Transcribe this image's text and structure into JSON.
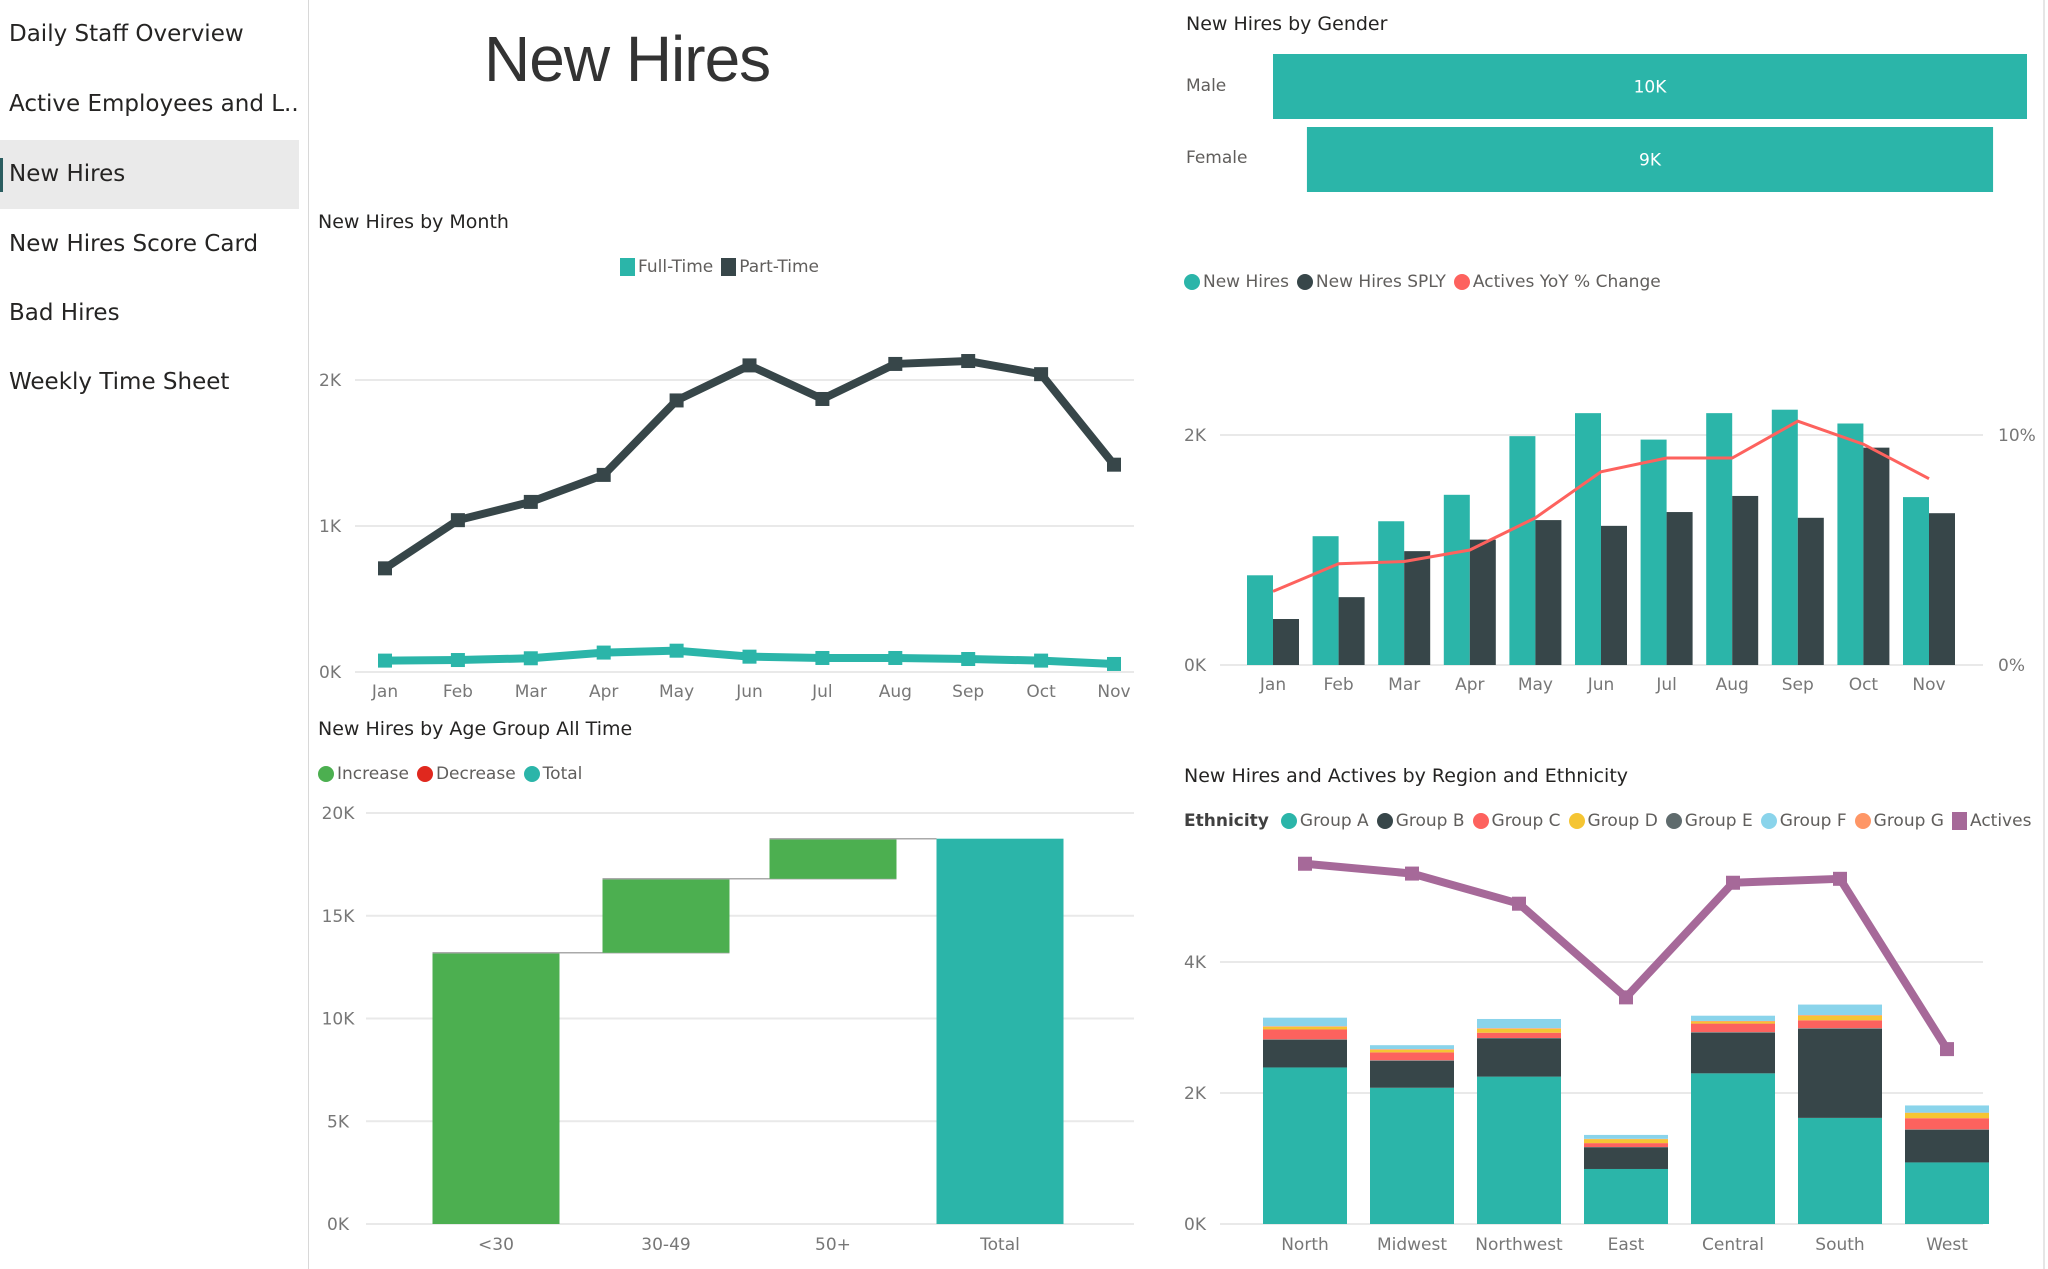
{
  "sidebar": {
    "items": [
      {
        "label": "Daily Staff Overview",
        "active": false
      },
      {
        "label": "Active Employees and L...",
        "active": false
      },
      {
        "label": "New Hires",
        "active": true
      },
      {
        "label": "New Hires Score Card",
        "active": false
      },
      {
        "label": "Bad Hires",
        "active": false
      },
      {
        "label": "Weekly Time Sheet",
        "active": false
      }
    ]
  },
  "page": {
    "title": "New Hires"
  },
  "colors": {
    "teal": "#2bb5a9",
    "dark": "#374649",
    "coral": "#fd625e",
    "green": "#4caf50",
    "red": "#e0281e",
    "yellow": "#f5c533",
    "grey": "#5f6b6d",
    "lightblue": "#8ad4eb",
    "orange": "#fe9666",
    "purple": "#a66999"
  },
  "chart_data": [
    {
      "id": "by_month",
      "type": "line",
      "title": "New Hires by Month",
      "legend": [
        {
          "name": "Full-Time",
          "color": "#2bb5a9"
        },
        {
          "name": "Part-Time",
          "color": "#374649"
        }
      ],
      "categories": [
        "Jan",
        "Feb",
        "Mar",
        "Apr",
        "May",
        "Jun",
        "Jul",
        "Aug",
        "Sep",
        "Oct",
        "Nov"
      ],
      "series": [
        {
          "name": "Full-Time",
          "values": [
            78,
            82,
            94,
            133,
            146,
            105,
            96,
            96,
            89,
            78,
            55
          ]
        },
        {
          "name": "Part-Time",
          "values": [
            710,
            1040,
            1165,
            1350,
            1860,
            2100,
            1870,
            2110,
            2130,
            2040,
            1420
          ]
        }
      ],
      "yticks": [
        "0K",
        "1K",
        "2K"
      ],
      "ytick_values": [
        0,
        1000,
        2000
      ],
      "ylim": [
        0,
        2000
      ],
      "grid": true,
      "legend_position": "top-center"
    },
    {
      "id": "by_gender",
      "type": "bar",
      "subtype": "funnel",
      "title": "New Hires by Gender",
      "categories": [
        "Male",
        "Female"
      ],
      "values": [
        10000,
        9100
      ],
      "data_labels": [
        "10K",
        "9K"
      ]
    },
    {
      "id": "new_vs_sply",
      "type": "bar",
      "subtype": "combo-clustered-bar-line",
      "title": "",
      "legend": [
        {
          "name": "New Hires",
          "color": "#2bb5a9"
        },
        {
          "name": "New Hires SPLY",
          "color": "#374649"
        },
        {
          "name": "Actives YoY % Change",
          "color": "#fd625e"
        }
      ],
      "categories": [
        "Jan",
        "Feb",
        "Mar",
        "Apr",
        "May",
        "Jun",
        "Jul",
        "Aug",
        "Sep",
        "Oct",
        "Nov"
      ],
      "series": [
        {
          "name": "New Hires",
          "axis": "left",
          "values": [
            780,
            1120,
            1250,
            1480,
            1990,
            2190,
            1960,
            2190,
            2220,
            2100,
            1460
          ]
        },
        {
          "name": "New Hires SPLY",
          "axis": "left",
          "values": [
            400,
            590,
            990,
            1090,
            1260,
            1210,
            1330,
            1470,
            1280,
            1890,
            1320
          ]
        },
        {
          "name": "Actives YoY % Change",
          "axis": "right",
          "values": [
            3.2,
            4.4,
            4.5,
            5.0,
            6.4,
            8.4,
            9.0,
            9.0,
            10.6,
            9.6,
            8.1
          ]
        }
      ],
      "yticks": [
        "0K",
        "2K"
      ],
      "ytick_values": [
        0,
        2000
      ],
      "ylim": [
        0,
        2000
      ],
      "y2ticks": [
        "0%",
        "10%"
      ],
      "y2tick_values": [
        0,
        10
      ],
      "y2lim": [
        0,
        10
      ],
      "grid": true,
      "legend_position": "top-left"
    },
    {
      "id": "by_age",
      "type": "bar",
      "subtype": "waterfall",
      "title": "New Hires by Age Group All Time",
      "legend": [
        {
          "name": "Increase",
          "color": "#4caf50"
        },
        {
          "name": "Decrease",
          "color": "#e0281e"
        },
        {
          "name": "Total",
          "color": "#2bb5a9"
        }
      ],
      "categories": [
        "<30",
        "30-49",
        "50+",
        "Total"
      ],
      "values": [
        13200,
        3600,
        1950,
        18750
      ],
      "kinds": [
        "increase",
        "increase",
        "increase",
        "total"
      ],
      "yticks": [
        "0K",
        "5K",
        "10K",
        "15K",
        "20K"
      ],
      "ytick_values": [
        0,
        5000,
        10000,
        15000,
        20000
      ],
      "ylim": [
        0,
        20000
      ],
      "grid": true,
      "legend_position": "top-left"
    },
    {
      "id": "by_region",
      "type": "bar",
      "subtype": "stacked-bar-with-line",
      "title": "New Hires and Actives by Region and Ethnicity",
      "legend_title": "Ethnicity",
      "legend": [
        {
          "name": "Group A",
          "color": "#2bb5a9",
          "shape": "dot"
        },
        {
          "name": "Group B",
          "color": "#374649",
          "shape": "dot"
        },
        {
          "name": "Group C",
          "color": "#fd625e",
          "shape": "dot"
        },
        {
          "name": "Group D",
          "color": "#f5c533",
          "shape": "dot"
        },
        {
          "name": "Group E",
          "color": "#5f6b6d",
          "shape": "dot"
        },
        {
          "name": "Group F",
          "color": "#8ad4eb",
          "shape": "dot"
        },
        {
          "name": "Group G",
          "color": "#fe9666",
          "shape": "dot"
        },
        {
          "name": "Actives",
          "color": "#a66999",
          "shape": "square"
        }
      ],
      "categories": [
        "North",
        "Midwest",
        "Northwest",
        "East",
        "Central",
        "South",
        "West"
      ],
      "series": [
        {
          "name": "Group A",
          "values": [
            2390,
            2080,
            2250,
            840,
            2300,
            1620,
            940
          ]
        },
        {
          "name": "Group B",
          "values": [
            420,
            410,
            580,
            330,
            620,
            1360,
            500
          ]
        },
        {
          "name": "Group E",
          "values": [
            10,
            10,
            10,
            5,
            10,
            10,
            5
          ]
        },
        {
          "name": "Group C",
          "values": [
            150,
            120,
            80,
            60,
            130,
            120,
            170
          ]
        },
        {
          "name": "Group D",
          "values": [
            40,
            40,
            60,
            60,
            30,
            70,
            80
          ]
        },
        {
          "name": "Group G",
          "values": [
            10,
            10,
            10,
            5,
            10,
            10,
            5
          ]
        },
        {
          "name": "Group F",
          "values": [
            130,
            60,
            140,
            60,
            80,
            160,
            110
          ]
        },
        {
          "name": "Actives",
          "type": "line",
          "values": [
            5500,
            5350,
            4890,
            3460,
            5210,
            5270,
            2670
          ]
        }
      ],
      "yticks": [
        "0K",
        "2K",
        "4K"
      ],
      "ytick_values": [
        0,
        2000,
        4000
      ],
      "ylim": [
        0,
        6000
      ],
      "grid": true,
      "legend_position": "top-left"
    }
  ]
}
